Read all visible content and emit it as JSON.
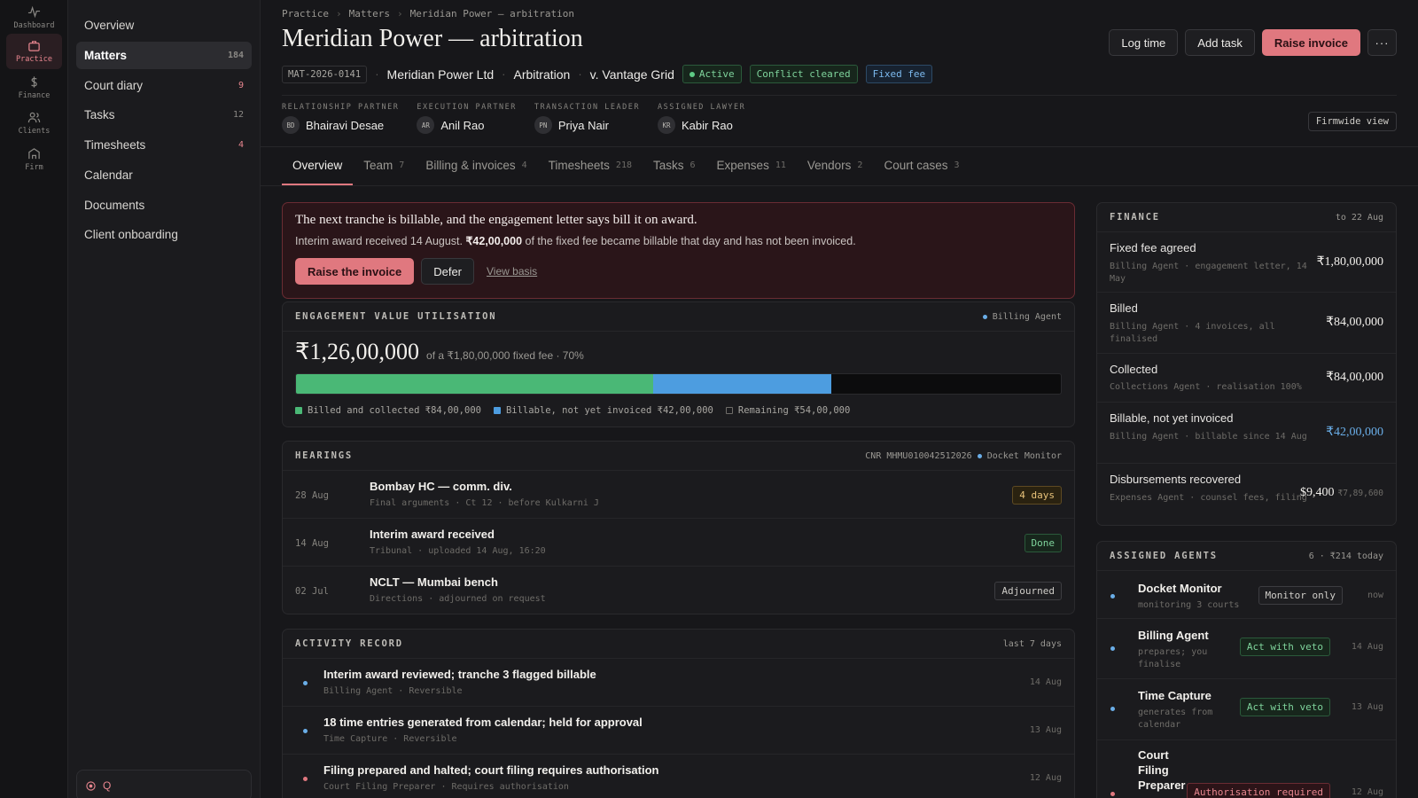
{
  "rail": [
    {
      "label": "Dashboard",
      "icon": "pulse-icon"
    },
    {
      "label": "Practice",
      "icon": "briefcase-icon",
      "active": true
    },
    {
      "label": "Finance",
      "icon": "dollar-icon"
    },
    {
      "label": "Clients",
      "icon": "users-icon"
    },
    {
      "label": "Firm",
      "icon": "building-icon"
    }
  ],
  "nav": [
    {
      "label": "Overview",
      "count": ""
    },
    {
      "label": "Matters",
      "count": "184",
      "active": true
    },
    {
      "label": "Court diary",
      "count": "9",
      "alert": true
    },
    {
      "label": "Tasks",
      "count": "12"
    },
    {
      "label": "Timesheets",
      "count": "4",
      "alert": true
    },
    {
      "label": "Calendar",
      "count": ""
    },
    {
      "label": "Documents",
      "count": ""
    },
    {
      "label": "Client onboarding",
      "count": ""
    }
  ],
  "search": {
    "label": "Q"
  },
  "breadcrumb": [
    "Practice",
    "Matters",
    "Meridian Power — arbitration"
  ],
  "title": "Meridian Power — arbitration",
  "actions": {
    "log_time": "Log time",
    "add_task": "Add task",
    "raise_invoice": "Raise invoice",
    "more": "···"
  },
  "meta": {
    "code": "MAT-2026-0141",
    "client": "Meridian Power Ltd",
    "type": "Arbitration",
    "opponent": "v. Vantage Grid",
    "badges": {
      "status": "Active",
      "conflict": "Conflict cleared",
      "fee": "Fixed fee"
    }
  },
  "people": [
    {
      "role": "RELATIONSHIP PARTNER",
      "initials": "BD",
      "name": "Bhairavi Desae"
    },
    {
      "role": "EXECUTION PARTNER",
      "initials": "AR",
      "name": "Anil Rao"
    },
    {
      "role": "TRANSACTION LEADER",
      "initials": "PN",
      "name": "Priya Nair"
    },
    {
      "role": "ASSIGNED LAWYER",
      "initials": "KR",
      "name": "Kabir Rao"
    }
  ],
  "firmwide": "Firmwide view",
  "tabs": [
    {
      "label": "Overview",
      "count": "",
      "active": true
    },
    {
      "label": "Team",
      "count": "7"
    },
    {
      "label": "Billing & invoices",
      "count": "4"
    },
    {
      "label": "Timesheets",
      "count": "218"
    },
    {
      "label": "Tasks",
      "count": "6"
    },
    {
      "label": "Expenses",
      "count": "11"
    },
    {
      "label": "Vendors",
      "count": "2"
    },
    {
      "label": "Court cases",
      "count": "3"
    }
  ],
  "alert": {
    "title": "The next tranche is billable, and the engagement letter says bill it on award.",
    "body_pre": "Interim award received 14 August. ",
    "body_amount": "₹42,00,000",
    "body_post": " of the fixed fee became billable that day and has not been invoiced.",
    "primary": "Raise the invoice",
    "secondary": "Defer",
    "link": "View basis"
  },
  "utilisation": {
    "title": "ENGAGEMENT VALUE UTILISATION",
    "agent": "Billing Agent",
    "value": "₹1,26,00,000",
    "of_text": "of a ₹1,80,00,000 fixed fee · 70%",
    "billed_fraction": 0.4667,
    "billable_fraction": 0.2333,
    "legend": {
      "billed": "Billed and collected ₹84,00,000",
      "billable": "Billable, not yet invoiced ₹42,00,000",
      "remaining": "Remaining ₹54,00,000"
    },
    "colors": {
      "billed": "#4ab876",
      "billable": "#4d9de0"
    }
  },
  "hearings": {
    "title": "HEARINGS",
    "cnr": "CNR MHMU010042512026",
    "agent": "Docket Monitor",
    "items": [
      {
        "date": "28 Aug",
        "title": "Bombay HC — comm. div.",
        "sub": "Final arguments · Ct 12 · before Kulkarni J",
        "badge": "4 days",
        "tone": "amber"
      },
      {
        "date": "14 Aug",
        "title": "Interim award received",
        "sub": "Tribunal · uploaded 14 Aug, 16:20",
        "badge": "Done",
        "tone": "green"
      },
      {
        "date": "02 Jul",
        "title": "NCLT — Mumbai bench",
        "sub": "Directions · adjourned on request",
        "badge": "Adjourned",
        "tone": "grey"
      }
    ]
  },
  "activity": {
    "title": "ACTIVITY RECORD",
    "range": "last 7 days",
    "items": [
      {
        "title": "Interim award reviewed; tranche 3 flagged billable",
        "sub": "Billing Agent · Reversible",
        "date": "14 Aug",
        "tone": "blue"
      },
      {
        "title": "18 time entries generated from calendar; held for approval",
        "sub": "Time Capture · Reversible",
        "date": "13 Aug",
        "tone": "blue"
      },
      {
        "title": "Filing prepared and halted; court filing requires authorisation",
        "sub": "Court Filing Preparer · Requires authorisation",
        "date": "12 Aug",
        "tone": "red"
      }
    ]
  },
  "finance": {
    "title": "FINANCE",
    "range": "to 22 Aug",
    "items": [
      {
        "label": "Fixed fee agreed",
        "sub": "Billing Agent · engagement letter, 14 May",
        "value": "₹1,80,00,000",
        "extra": ""
      },
      {
        "label": "Billed",
        "sub": "Billing Agent · 4 invoices, all finalised",
        "value": "₹84,00,000",
        "extra": ""
      },
      {
        "label": "Collected",
        "sub": "Collections Agent · realisation 100%",
        "value": "₹84,00,000",
        "extra": ""
      },
      {
        "label": "Billable, not yet invoiced",
        "sub": "Billing Agent · billable since 14 Aug",
        "value": "₹42,00,000",
        "extra": "",
        "tone": "blue"
      },
      {
        "label": "Disbursements recovered",
        "sub": "Expenses Agent · counsel fees, filing",
        "value": "$9,400",
        "extra": "₹7,89,600"
      }
    ]
  },
  "agents": {
    "title": "ASSIGNED AGENTS",
    "summary": "6 · ₹214 today",
    "items": [
      {
        "name": "Docket Monitor",
        "sub": "monitoring 3 courts",
        "badge": "Monitor only",
        "tone": "grey",
        "date": "now"
      },
      {
        "name": "Billing Agent",
        "sub": "prepares; you finalise",
        "badge": "Act with veto",
        "tone": "green",
        "date": "14 Aug"
      },
      {
        "name": "Time Capture",
        "sub": "generates from calendar",
        "badge": "Act with veto",
        "tone": "green",
        "date": "13 Aug"
      },
      {
        "name": "Court Filing Preparer",
        "sub": "",
        "badge": "Authorisation required",
        "tone": "red",
        "date": "12 Aug"
      }
    ]
  }
}
